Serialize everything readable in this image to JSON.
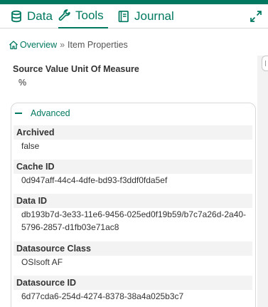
{
  "tabs": [
    {
      "label": "Data",
      "icon": "database-icon"
    },
    {
      "label": "Tools",
      "icon": "wrench-icon"
    },
    {
      "label": "Journal",
      "icon": "book-icon"
    }
  ],
  "breadcrumb": {
    "home": "Overview",
    "separator": "»",
    "current": "Item Properties"
  },
  "uom": {
    "label": "Source Value Unit Of Measure",
    "value": "%"
  },
  "advanced": {
    "title": "Advanced",
    "properties": [
      {
        "label": "Archived",
        "value": "false"
      },
      {
        "label": "Cache ID",
        "value": "0d947aff-44c4-4dfe-bd93-f3ddf0fda5ef"
      },
      {
        "label": "Data ID",
        "value": "db193b7d-3e33-11e6-9456-025ed0f19b59/b7c7a26d-2a40-",
        "value2": "5796-2857-d1fb03e71ac8"
      },
      {
        "label": "Datasource Class",
        "value": "OSIsoft AF"
      },
      {
        "label": "Datasource ID",
        "value": "6d77cda6-254d-4274-8378-38a4a025b3c7"
      }
    ]
  },
  "colors": {
    "accent": "#007960"
  }
}
